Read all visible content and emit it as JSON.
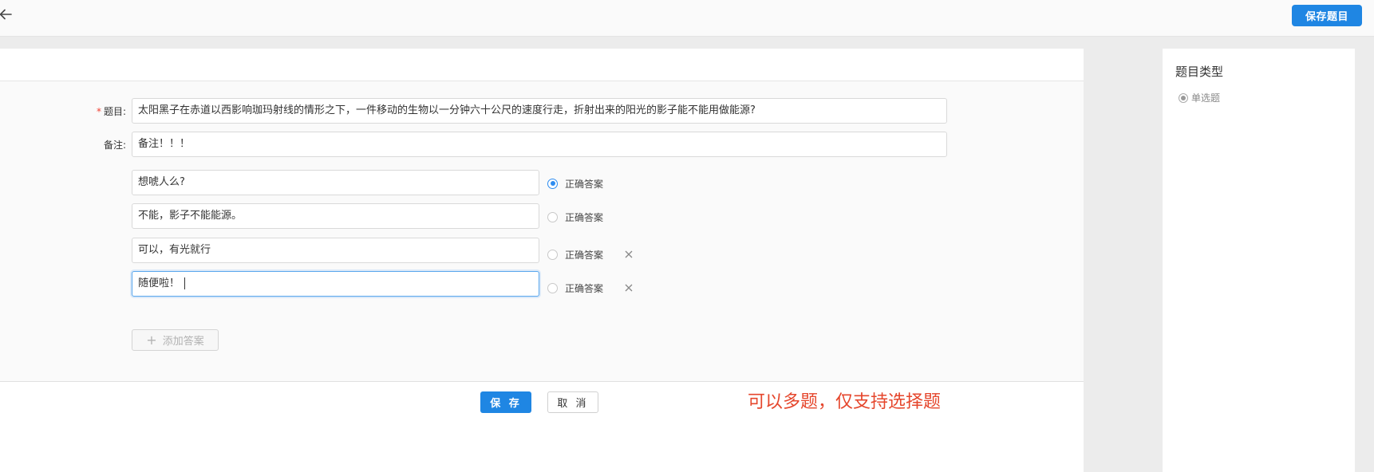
{
  "toolbar": {
    "save_question_label": "保存题目"
  },
  "form": {
    "question_label": "题目:",
    "question_value": "太阳黑子在赤道以西影响珈玛射线的情形之下，一件移动的生物以一分钟六十公尺的速度行走，折射出来的阳光的影子能不能用做能源?",
    "remark_label": "备注:",
    "remark_value": "备注！！！",
    "answers": [
      {
        "text": "想唬人么?",
        "correct_label": "正确答案",
        "correct": true
      },
      {
        "text": "不能，影子不能能源。",
        "correct_label": "正确答案",
        "correct": false
      },
      {
        "text": "可以，有光就行",
        "correct_label": "正确答案",
        "correct": false
      },
      {
        "text": "随便啦！",
        "correct_label": "正确答案",
        "correct": false
      }
    ],
    "add_answer_label": "添加答案",
    "save_label": "保 存",
    "cancel_label": "取 消"
  },
  "annotation": "可以多题，仅支持选择题",
  "side_panel": {
    "title": "题目类型",
    "type_option": "单选题"
  },
  "colors": {
    "primary": "#1f86e3",
    "annotation": "#e5462c",
    "required": "#f04134"
  },
  "icons": {
    "back": "arrow-left-icon",
    "remove": "close-icon",
    "add": "plus-icon"
  }
}
